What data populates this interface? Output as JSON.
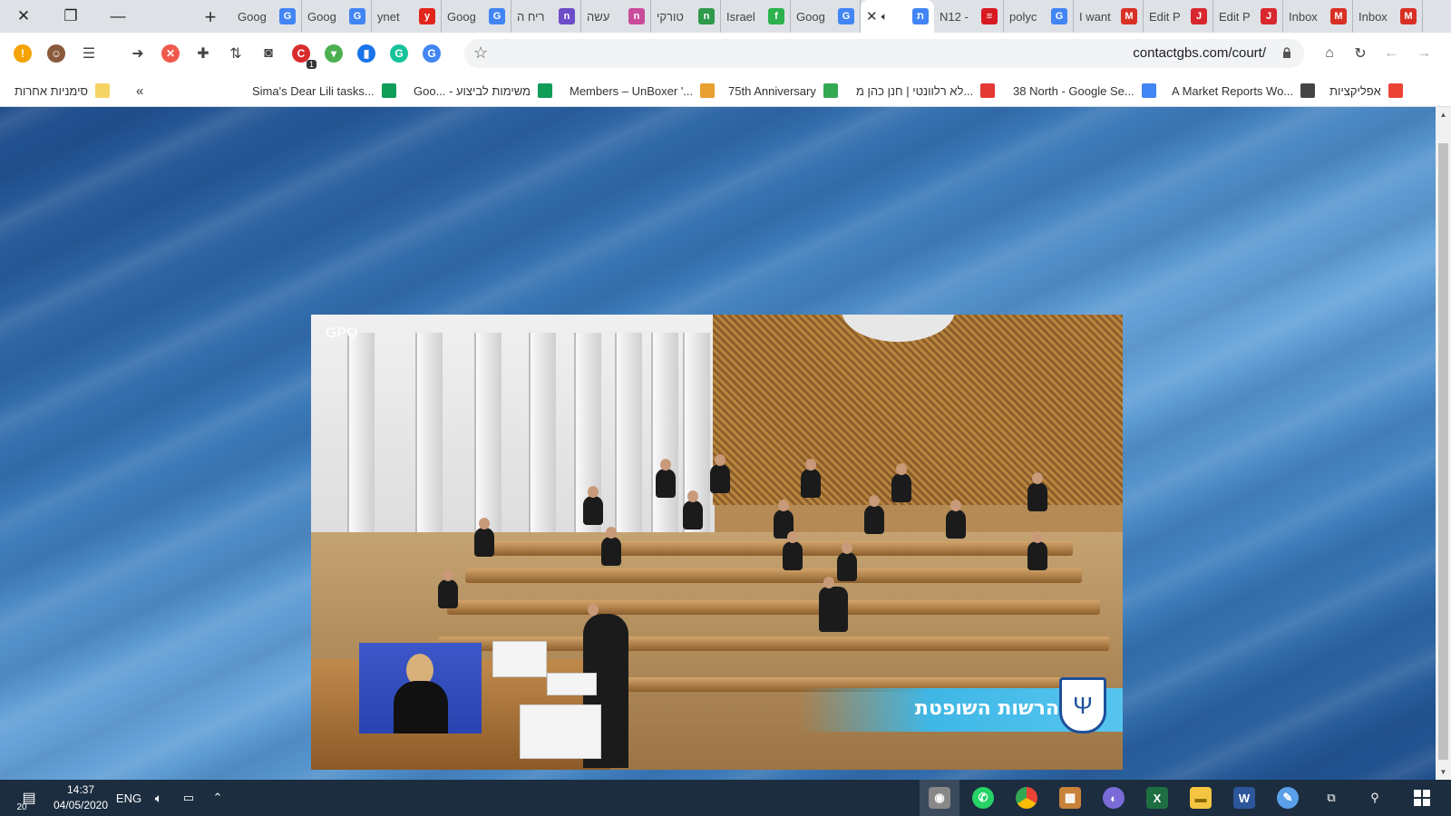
{
  "tabs": [
    {
      "title": "Goog",
      "favicon": "google-translate-icon",
      "color": "#4285f4",
      "glyph": "G"
    },
    {
      "title": "Goog",
      "favicon": "google-translate-icon",
      "color": "#4285f4",
      "glyph": "G"
    },
    {
      "title": "ynet",
      "favicon": "ynet-icon",
      "color": "#e1251b",
      "glyph": "y"
    },
    {
      "title": "Goog",
      "favicon": "google-translate-icon",
      "color": "#4285f4",
      "glyph": "G"
    },
    {
      "title": "ריח ה",
      "favicon": "news-icon",
      "color": "#6d4cc9",
      "glyph": "n"
    },
    {
      "title": "עשה",
      "favicon": "news-icon",
      "color": "#c94c9a",
      "glyph": "n"
    },
    {
      "title": "טורקי",
      "favicon": "news-icon",
      "color": "#2f9a4c",
      "glyph": "n"
    },
    {
      "title": "Israel",
      "favicon": "feedly-icon",
      "color": "#2bb24c",
      "glyph": "f"
    },
    {
      "title": "Goog",
      "favicon": "google-translate-icon",
      "color": "#4285f4",
      "glyph": "G"
    },
    {
      "title": "",
      "favicon": "hebrew-site-icon",
      "color": "#4285f4",
      "glyph": "ת",
      "active": true
    },
    {
      "title": "N12 -",
      "favicon": "n12-icon",
      "color": "#d71920",
      "glyph": "≡"
    },
    {
      "title": "polyc",
      "favicon": "google-icon",
      "color": "#4285f4",
      "glyph": "G"
    },
    {
      "title": "I want",
      "favicon": "gmail-icon",
      "color": "#d93025",
      "glyph": "M"
    },
    {
      "title": "Edit P",
      "favicon": "joomla-icon",
      "color": "#d9272e",
      "glyph": "J"
    },
    {
      "title": "Edit P",
      "favicon": "joomla-icon",
      "color": "#d9272e",
      "glyph": "J"
    },
    {
      "title": "Inbox",
      "favicon": "gmail-icon",
      "color": "#d93025",
      "glyph": "M"
    },
    {
      "title": "Inbox",
      "favicon": "gmail-icon",
      "color": "#d93025",
      "glyph": "M"
    }
  ],
  "toolbar": {
    "url": "contactgbs.com/court/",
    "extension_badge": "1"
  },
  "bookmarks": {
    "other_bookmarks": "סימניות אחרות",
    "overflow": "«",
    "items": [
      {
        "label": "Sima's Dear Lili tasks...",
        "icon": "sheets-icon",
        "color": "#0f9d58"
      },
      {
        "label": "Goo... - משימות לביצוע",
        "icon": "sheets-icon",
        "color": "#0f9d58"
      },
      {
        "label": "Members – UnBoxer '...",
        "icon": "unboxer-icon",
        "color": "#e8a030"
      },
      {
        "label": "75th Anniversary",
        "icon": "anniversary-icon",
        "color": "#34a853"
      },
      {
        "label": "לא רלוונטי | חנן כהן מ...",
        "icon": "bookmark-site-icon",
        "color": "#e53935"
      },
      {
        "label": "38 North - Google Se...",
        "icon": "google-icon",
        "color": "#4285f4"
      },
      {
        "label": "A Market Reports Wo...",
        "icon": "globe-icon",
        "color": "#444444"
      },
      {
        "label": "אפליקציות",
        "icon": "apps-grid-icon",
        "color": "#ea4335"
      }
    ]
  },
  "video": {
    "watermark": "GPO",
    "banner_text": "הרשות השופטת"
  },
  "taskbar": {
    "notification_count": "20",
    "time": "14:37",
    "date": "04/05/2020",
    "language": "ENG"
  }
}
